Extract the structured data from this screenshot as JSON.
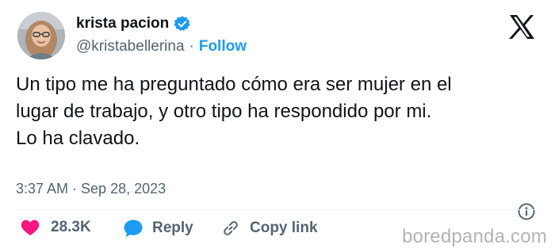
{
  "author": {
    "name": "krista pacion",
    "handle": "@kristabellerina",
    "separator": "·",
    "follow_label": "Follow"
  },
  "tweet": {
    "lines": [
      "Un tipo me ha preguntado cómo era ser mujer en el",
      "lugar de trabajo, y otro tipo ha respondido por mi.",
      "Lo ha clavado."
    ],
    "timestamp": "3:37 AM · Sep 28, 2023"
  },
  "actions": {
    "likes": "28.3K",
    "reply_label": "Reply",
    "copy_link_label": "Copy link"
  },
  "icons": {
    "verified": "verified-badge-icon",
    "platform": "x-logo-icon",
    "info": "info-icon",
    "like": "heart-icon",
    "reply": "reply-bubble-icon",
    "link": "link-icon"
  },
  "colors": {
    "accent": "#1d9bf0",
    "like": "#f91880",
    "muted": "#536471",
    "text": "#0f1419"
  },
  "watermark": "boredpanda.com"
}
